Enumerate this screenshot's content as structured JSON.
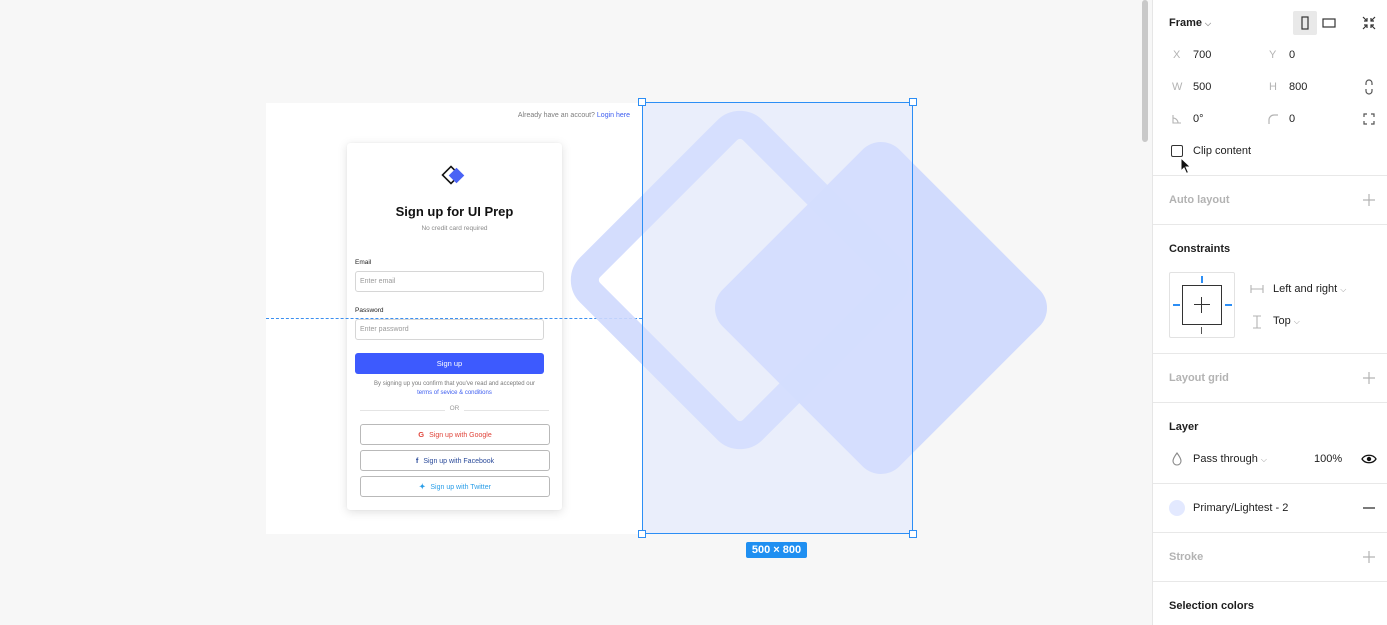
{
  "signup": {
    "login_prompt": "Already have an accout?",
    "login_link": "Login here",
    "title": "Sign up for UI Prep",
    "subtitle": "No credit card required",
    "email_label": "Email",
    "email_placeholder": "Enter email",
    "password_label": "Password",
    "password_placeholder": "Enter password",
    "submit_label": "Sign up",
    "terms_text": "By signing up you confirm that you've read and accepted our",
    "terms_link": "terms of sevice & conditions",
    "or_label": "OR",
    "google_label": "Sign up with Google",
    "facebook_label": "Sign up with Facebook",
    "twitter_label": "Sign up with Twitter"
  },
  "canvas": {
    "size_badge": "500 × 800"
  },
  "panel": {
    "frame_title": "Frame",
    "x_label": "X",
    "x_value": "700",
    "y_label": "Y",
    "y_value": "0",
    "w_label": "W",
    "w_value": "500",
    "h_label": "H",
    "h_value": "800",
    "rotation_value": "0°",
    "radius_value": "0",
    "clip_content_label": "Clip content",
    "clip_content_checked": false,
    "auto_layout_title": "Auto layout",
    "constraints_title": "Constraints",
    "horizontal_constraint": "Left and right",
    "vertical_constraint": "Top",
    "layout_grid_title": "Layout grid",
    "layer_title": "Layer",
    "blend_mode": "Pass through",
    "opacity": "100%",
    "fill_name": "Primary/Lightest - 2",
    "fill_color": "#e3e9ff",
    "stroke_title": "Stroke",
    "selection_colors_title": "Selection colors"
  },
  "colors": {
    "accent": "#2c8ef5",
    "primary": "#3d5afe"
  }
}
